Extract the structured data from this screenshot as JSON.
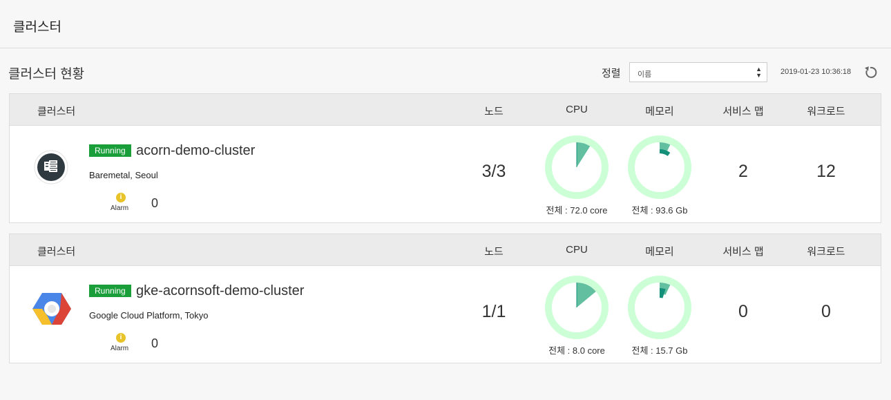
{
  "header": {
    "title": "클러스터"
  },
  "overview": {
    "title": "클러스터 현황",
    "sort_label": "정렬",
    "sort_value": "이름",
    "timestamp": "2019-01-23 10:36:18"
  },
  "columns": {
    "cluster": "클러스터",
    "node": "노드",
    "cpu": "CPU",
    "memory": "메모리",
    "service_map": "서비스 맵",
    "workload": "워크로드"
  },
  "clusters": [
    {
      "status": "Running",
      "name": "acorn-demo-cluster",
      "location": "Baremetal, Seoul",
      "icon": "baremetal-server-icon",
      "alarm_label": "Alarm",
      "alarm_count": "0",
      "nodes": "3/3",
      "cpu_total": "전체 : 72.0 core",
      "cpu_usage_fraction": 0.09,
      "memory_total": "전체 : 93.6 Gb",
      "memory_usage_fraction": 0.07,
      "memory_request_fraction": 0.1,
      "service_maps": "2",
      "workloads": "12"
    },
    {
      "status": "Running",
      "name": "gke-acornsoft-demo-cluster",
      "location": "Google Cloud Platform, Tokyo",
      "icon": "google-cloud-platform-icon",
      "alarm_label": "Alarm",
      "alarm_count": "0",
      "nodes": "1/1",
      "cpu_total": "전체 : 8.0 core",
      "cpu_usage_fraction": 0.14,
      "memory_total": "전체 : 15.7 Gb",
      "memory_usage_fraction": 0.07,
      "memory_request_fraction": 0.05,
      "service_maps": "0",
      "workloads": "0"
    }
  ],
  "colors": {
    "running": "#1a9e3a",
    "donut_track": "#ccffd6",
    "donut_used": "#62c0a0",
    "donut_request": "#14907a",
    "alarm": "#e8c42a"
  }
}
